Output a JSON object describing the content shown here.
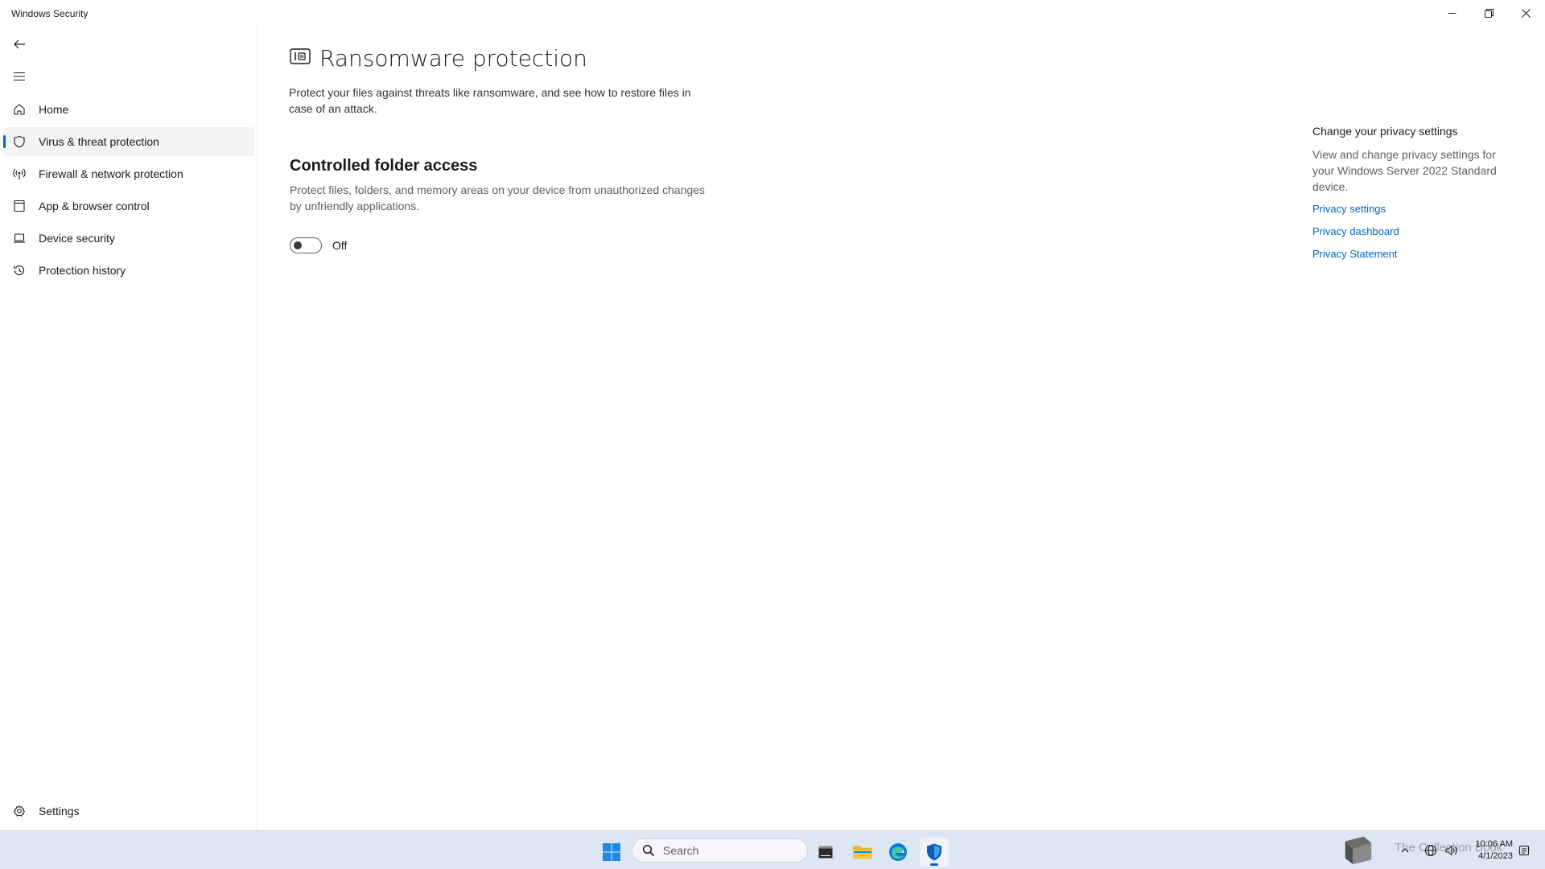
{
  "window": {
    "title": "Windows Security"
  },
  "sidebar": {
    "items": [
      {
        "label": "Home",
        "icon": "home-icon"
      },
      {
        "label": "Virus & threat protection",
        "icon": "shield-icon",
        "active": true
      },
      {
        "label": "Firewall & network protection",
        "icon": "antenna-icon"
      },
      {
        "label": "App & browser control",
        "icon": "app-window-icon"
      },
      {
        "label": "Device security",
        "icon": "laptop-icon"
      },
      {
        "label": "Protection history",
        "icon": "history-icon"
      }
    ],
    "settings_label": "Settings"
  },
  "main": {
    "title": "Ransomware protection",
    "description": "Protect your files against threats like ransomware, and see how to restore files in case of an attack.",
    "section": {
      "title": "Controlled folder access",
      "description": "Protect files, folders, and memory areas on your device from unauthorized changes by unfriendly applications.",
      "toggle_state": "Off"
    }
  },
  "side_panel": {
    "title": "Change your privacy settings",
    "description": "View and change privacy settings for your Windows Server 2022 Standard device.",
    "links": [
      "Privacy settings",
      "Privacy dashboard",
      "Privacy Statement"
    ]
  },
  "taskbar": {
    "search_placeholder": "Search",
    "time": "10:06 AM",
    "date": "4/1/2023",
    "watermark": "The Collection Book"
  },
  "colors": {
    "accent": "#0067c0",
    "taskbar_bg": "#dde6f3"
  }
}
